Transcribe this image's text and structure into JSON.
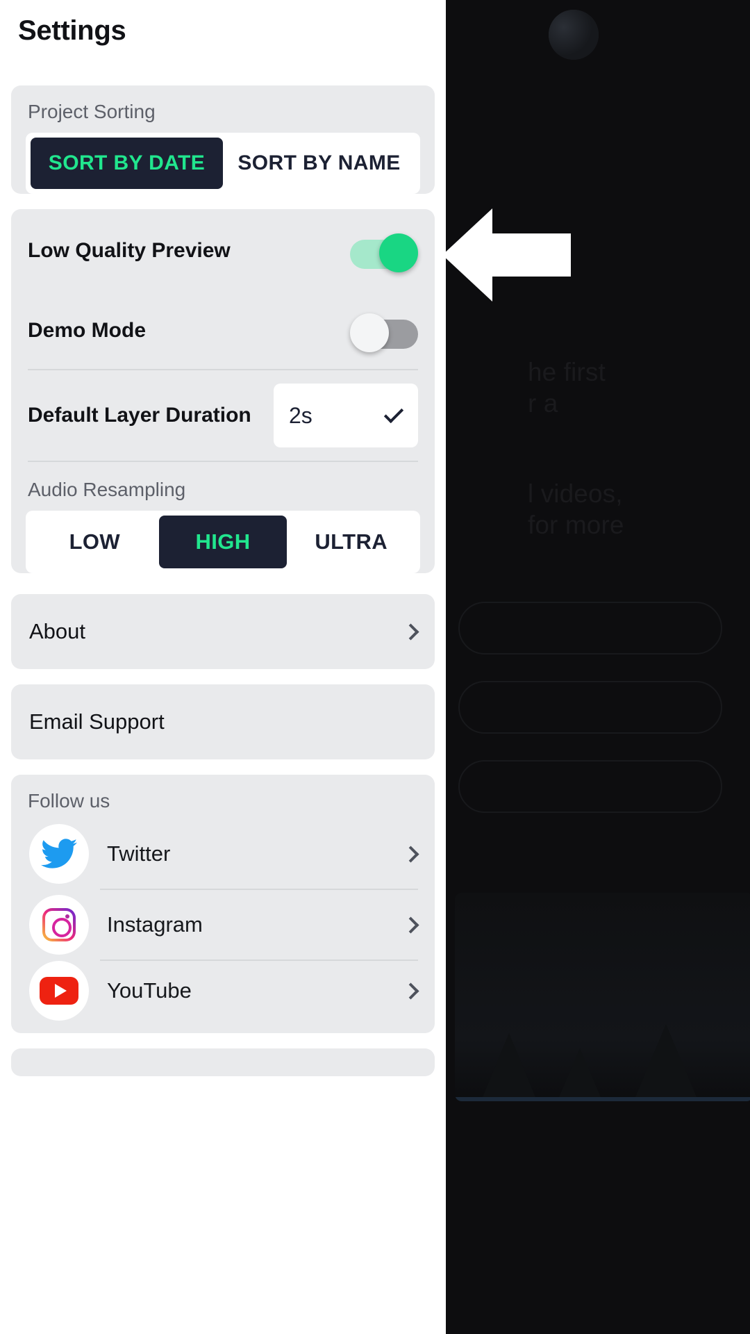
{
  "drawer": {
    "title": "Settings",
    "project_sorting": {
      "label": "Project Sorting",
      "options": [
        "SORT BY DATE",
        "SORT BY NAME"
      ],
      "selected": "SORT BY DATE"
    },
    "low_quality_preview": {
      "label": "Low Quality Preview",
      "state": "on"
    },
    "demo_mode": {
      "label": "Demo Mode",
      "state": "off"
    },
    "default_layer_duration": {
      "label": "Default Layer Duration",
      "value": "2s",
      "chevron": "chevron-down-icon"
    },
    "audio_resampling": {
      "label": "Audio Resampling",
      "options": [
        "LOW",
        "HIGH",
        "ULTRA"
      ],
      "selected": "HIGH"
    },
    "about": {
      "label": "About",
      "chevron": "chevron-right-icon"
    },
    "email_support": {
      "label": "Email Support"
    },
    "follow_us": {
      "label": "Follow us",
      "items": [
        {
          "name": "Twitter",
          "icon": "twitter-icon",
          "chevron": "chevron-right-icon"
        },
        {
          "name": "Instagram",
          "icon": "instagram-icon",
          "chevron": "chevron-right-icon"
        },
        {
          "name": "YouTube",
          "icon": "youtube-icon",
          "chevron": "chevron-right-icon"
        }
      ]
    }
  },
  "background": {
    "text_fragments": [
      "he first",
      "r a",
      "l videos,",
      "for more"
    ]
  },
  "annotation": {
    "type": "arrow-left",
    "points_at": "low-quality-preview-toggle",
    "color": "#ffffff"
  },
  "colors": {
    "accent_green": "#19d683",
    "accent_green_track": "#a5e8cb",
    "dark_navy": "#1c2133",
    "segment_green_text": "#21e68e",
    "card_gray": "#e9eaec",
    "drawer_white": "#ffffff",
    "twitter_blue": "#1d9bf0",
    "youtube_red": "#ee2211"
  }
}
